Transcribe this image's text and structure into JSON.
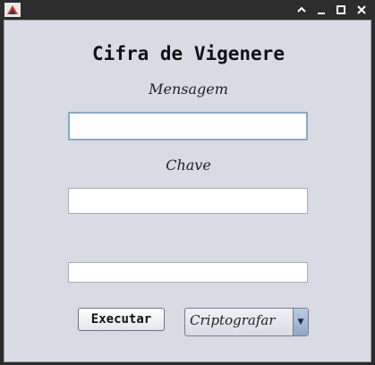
{
  "window": {
    "icon": "java-app-icon",
    "controls": [
      "chevron-up-icon",
      "minimize-icon",
      "maximize-icon",
      "close-icon"
    ]
  },
  "form": {
    "title": "Cifra de Vigenere",
    "message_label": "Mensagem",
    "message_value": "",
    "key_label": "Chave",
    "key_value": "",
    "result_value": "",
    "execute_label": "Executar",
    "mode_selected": "Criptografar"
  },
  "colors": {
    "panel_background": "#d8dbe3",
    "titlebar": "#2d2d2d",
    "focus_border": "#8aa8c8"
  }
}
